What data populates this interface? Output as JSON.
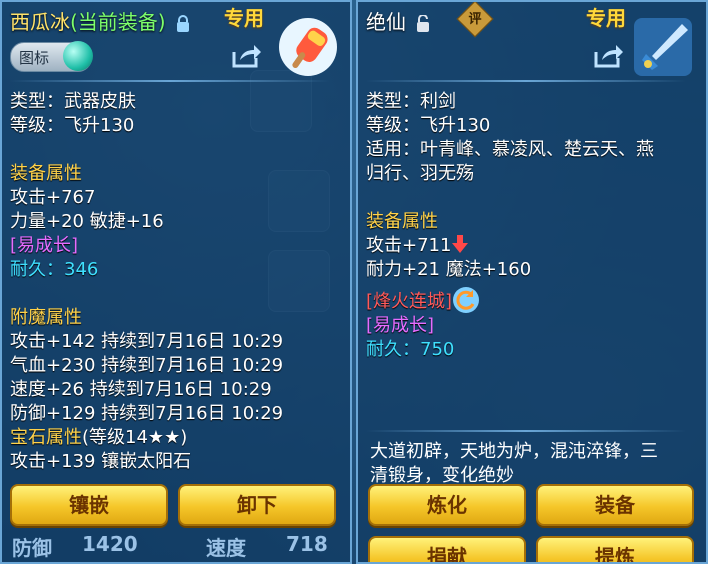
{
  "left": {
    "title_name": "西瓜冰",
    "title_status": "(当前装备)",
    "exclusive_label": "专用",
    "toggle_label": "图标",
    "type_line": "类型：武器皮肤",
    "level_line": "等级：飞升130",
    "equip_attr_header": "装备属性",
    "attack": "攻击+767",
    "stats": "力量+20 敏捷+16",
    "growth": "[易成长]",
    "durability": "耐久：346",
    "enchant_header": "附魔属性",
    "enchant": [
      "攻击+142 持续到7月16日 10:29",
      "气血+230 持续到7月16日 10:29",
      "速度+26 持续到7月16日 10:29",
      "防御+129 持续到7月16日 10:29"
    ],
    "gem_header": "宝石属性",
    "gem_level": "(等级14★★)",
    "gem_line": "攻击+139 镶嵌太阳石",
    "buttons": [
      "镶嵌",
      "卸下"
    ],
    "below_text": [
      "防御",
      "1420",
      "速度",
      "718"
    ]
  },
  "right": {
    "title_name": "绝仙",
    "rate_label": "评",
    "exclusive_label": "专用",
    "type_line": "类型：利剑",
    "level_line": "等级：飞升130",
    "suit_line1": "适用：叶青峰、慕凌风、楚云天、燕",
    "suit_line2": "归行、羽无殇",
    "equip_attr_header": "装备属性",
    "attack": "攻击+711",
    "stats": "耐力+21 魔法+160",
    "special": "[烽火连城]",
    "growth": "[易成长]",
    "durability": "耐久：750",
    "desc1": "大道初辟，天地为炉，混沌淬锋，三",
    "desc2": "清锻身，变化绝妙",
    "buttons": [
      "炼化",
      "装备",
      "捐献",
      "提炼"
    ]
  },
  "colors": {
    "gold": "#ffd24a",
    "growth": "#e66cff",
    "durability": "#3fe0ff",
    "special": "#ff5a5a"
  }
}
